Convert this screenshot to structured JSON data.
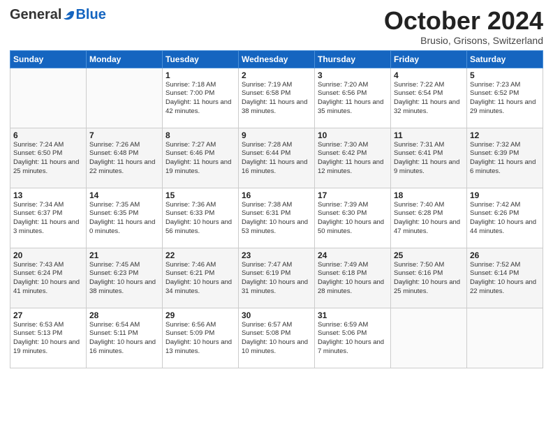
{
  "logo": {
    "general": "General",
    "blue": "Blue"
  },
  "title": "October 2024",
  "location": "Brusio, Grisons, Switzerland",
  "days_of_week": [
    "Sunday",
    "Monday",
    "Tuesday",
    "Wednesday",
    "Thursday",
    "Friday",
    "Saturday"
  ],
  "weeks": [
    [
      {
        "day": "",
        "info": ""
      },
      {
        "day": "",
        "info": ""
      },
      {
        "day": "1",
        "info": "Sunrise: 7:18 AM\nSunset: 7:00 PM\nDaylight: 11 hours and 42 minutes."
      },
      {
        "day": "2",
        "info": "Sunrise: 7:19 AM\nSunset: 6:58 PM\nDaylight: 11 hours and 38 minutes."
      },
      {
        "day": "3",
        "info": "Sunrise: 7:20 AM\nSunset: 6:56 PM\nDaylight: 11 hours and 35 minutes."
      },
      {
        "day": "4",
        "info": "Sunrise: 7:22 AM\nSunset: 6:54 PM\nDaylight: 11 hours and 32 minutes."
      },
      {
        "day": "5",
        "info": "Sunrise: 7:23 AM\nSunset: 6:52 PM\nDaylight: 11 hours and 29 minutes."
      }
    ],
    [
      {
        "day": "6",
        "info": "Sunrise: 7:24 AM\nSunset: 6:50 PM\nDaylight: 11 hours and 25 minutes."
      },
      {
        "day": "7",
        "info": "Sunrise: 7:26 AM\nSunset: 6:48 PM\nDaylight: 11 hours and 22 minutes."
      },
      {
        "day": "8",
        "info": "Sunrise: 7:27 AM\nSunset: 6:46 PM\nDaylight: 11 hours and 19 minutes."
      },
      {
        "day": "9",
        "info": "Sunrise: 7:28 AM\nSunset: 6:44 PM\nDaylight: 11 hours and 16 minutes."
      },
      {
        "day": "10",
        "info": "Sunrise: 7:30 AM\nSunset: 6:42 PM\nDaylight: 11 hours and 12 minutes."
      },
      {
        "day": "11",
        "info": "Sunrise: 7:31 AM\nSunset: 6:41 PM\nDaylight: 11 hours and 9 minutes."
      },
      {
        "day": "12",
        "info": "Sunrise: 7:32 AM\nSunset: 6:39 PM\nDaylight: 11 hours and 6 minutes."
      }
    ],
    [
      {
        "day": "13",
        "info": "Sunrise: 7:34 AM\nSunset: 6:37 PM\nDaylight: 11 hours and 3 minutes."
      },
      {
        "day": "14",
        "info": "Sunrise: 7:35 AM\nSunset: 6:35 PM\nDaylight: 11 hours and 0 minutes."
      },
      {
        "day": "15",
        "info": "Sunrise: 7:36 AM\nSunset: 6:33 PM\nDaylight: 10 hours and 56 minutes."
      },
      {
        "day": "16",
        "info": "Sunrise: 7:38 AM\nSunset: 6:31 PM\nDaylight: 10 hours and 53 minutes."
      },
      {
        "day": "17",
        "info": "Sunrise: 7:39 AM\nSunset: 6:30 PM\nDaylight: 10 hours and 50 minutes."
      },
      {
        "day": "18",
        "info": "Sunrise: 7:40 AM\nSunset: 6:28 PM\nDaylight: 10 hours and 47 minutes."
      },
      {
        "day": "19",
        "info": "Sunrise: 7:42 AM\nSunset: 6:26 PM\nDaylight: 10 hours and 44 minutes."
      }
    ],
    [
      {
        "day": "20",
        "info": "Sunrise: 7:43 AM\nSunset: 6:24 PM\nDaylight: 10 hours and 41 minutes."
      },
      {
        "day": "21",
        "info": "Sunrise: 7:45 AM\nSunset: 6:23 PM\nDaylight: 10 hours and 38 minutes."
      },
      {
        "day": "22",
        "info": "Sunrise: 7:46 AM\nSunset: 6:21 PM\nDaylight: 10 hours and 34 minutes."
      },
      {
        "day": "23",
        "info": "Sunrise: 7:47 AM\nSunset: 6:19 PM\nDaylight: 10 hours and 31 minutes."
      },
      {
        "day": "24",
        "info": "Sunrise: 7:49 AM\nSunset: 6:18 PM\nDaylight: 10 hours and 28 minutes."
      },
      {
        "day": "25",
        "info": "Sunrise: 7:50 AM\nSunset: 6:16 PM\nDaylight: 10 hours and 25 minutes."
      },
      {
        "day": "26",
        "info": "Sunrise: 7:52 AM\nSunset: 6:14 PM\nDaylight: 10 hours and 22 minutes."
      }
    ],
    [
      {
        "day": "27",
        "info": "Sunrise: 6:53 AM\nSunset: 5:13 PM\nDaylight: 10 hours and 19 minutes."
      },
      {
        "day": "28",
        "info": "Sunrise: 6:54 AM\nSunset: 5:11 PM\nDaylight: 10 hours and 16 minutes."
      },
      {
        "day": "29",
        "info": "Sunrise: 6:56 AM\nSunset: 5:09 PM\nDaylight: 10 hours and 13 minutes."
      },
      {
        "day": "30",
        "info": "Sunrise: 6:57 AM\nSunset: 5:08 PM\nDaylight: 10 hours and 10 minutes."
      },
      {
        "day": "31",
        "info": "Sunrise: 6:59 AM\nSunset: 5:06 PM\nDaylight: 10 hours and 7 minutes."
      },
      {
        "day": "",
        "info": ""
      },
      {
        "day": "",
        "info": ""
      }
    ]
  ]
}
